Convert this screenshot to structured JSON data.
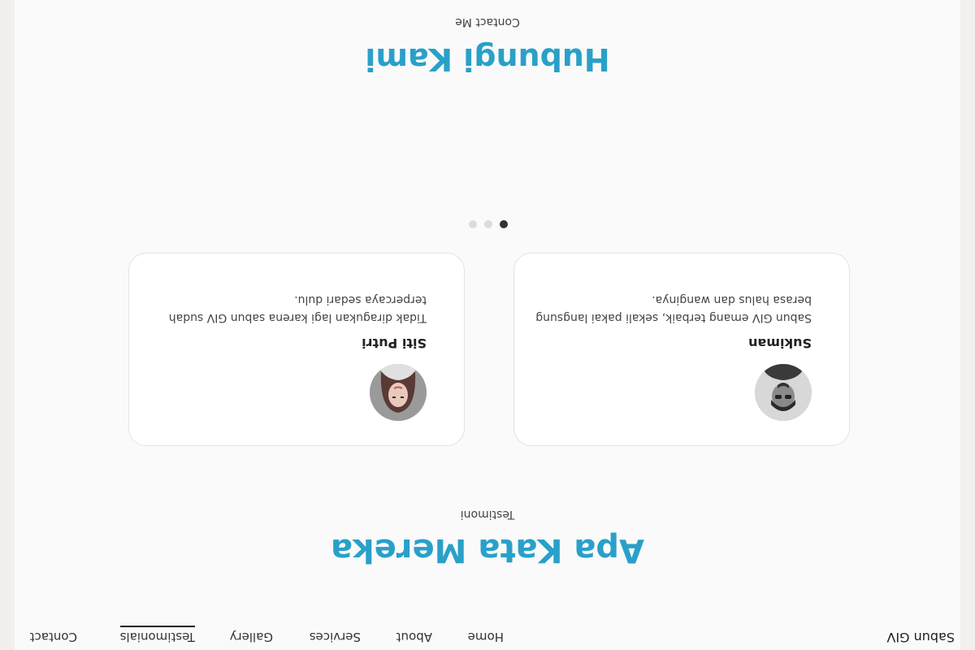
{
  "navbar": {
    "brand": "Sabun GIV",
    "links": [
      {
        "label": "Home"
      },
      {
        "label": "About"
      },
      {
        "label": "Services"
      },
      {
        "label": "Gallery"
      },
      {
        "label": "Testimonials",
        "active": true
      },
      {
        "label": "Contact"
      }
    ]
  },
  "testimonials": {
    "title": "Apa Kata Mereka",
    "subtitle": "Testimoni",
    "cards": [
      {
        "name": "Sukiman",
        "text": "Sabun GIV emang terbaik, sekali pakai langsung berasa halus dan wanginya.",
        "avatar_icon": "man-avatar-icon"
      },
      {
        "name": "Siti Putri",
        "text": "Tidak diragukan lagi karena sabun GIV sudah terpercaya sedari dulu.",
        "avatar_icon": "woman-avatar-icon"
      }
    ],
    "carousel": {
      "total": 3,
      "active_index": 0
    }
  },
  "contact": {
    "title": "Hubungi Kami",
    "subtitle": "Contact Me"
  },
  "colors": {
    "accent": "#2aa0c8",
    "page_bg": "#fafafa",
    "outer_bg": "#f2efee"
  }
}
